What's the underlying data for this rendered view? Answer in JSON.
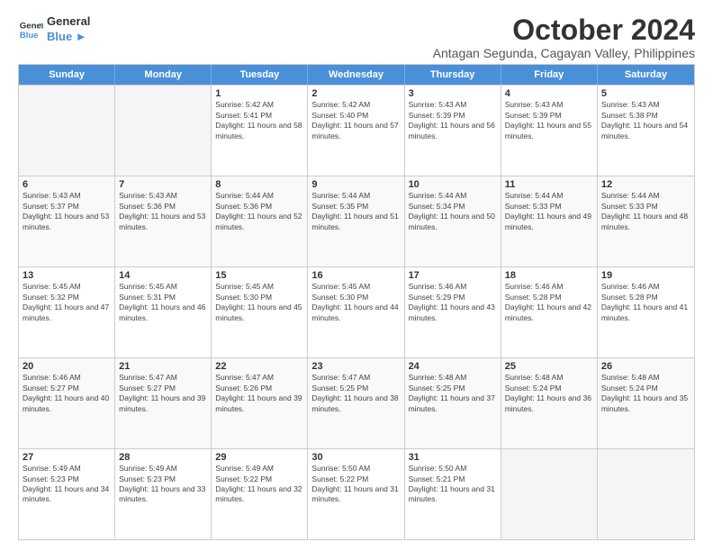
{
  "logo": {
    "line1": "General",
    "line2": "Blue",
    "arrow_color": "#4a90d9"
  },
  "title": "October 2024",
  "location": "Antagan Segunda, Cagayan Valley, Philippines",
  "header_days": [
    "Sunday",
    "Monday",
    "Tuesday",
    "Wednesday",
    "Thursday",
    "Friday",
    "Saturday"
  ],
  "weeks": [
    [
      {
        "day": "",
        "empty": true
      },
      {
        "day": "",
        "empty": true
      },
      {
        "day": "1",
        "sunrise": "5:42 AM",
        "sunset": "5:41 PM",
        "daylight": "11 hours and 58 minutes."
      },
      {
        "day": "2",
        "sunrise": "5:42 AM",
        "sunset": "5:40 PM",
        "daylight": "11 hours and 57 minutes."
      },
      {
        "day": "3",
        "sunrise": "5:43 AM",
        "sunset": "5:39 PM",
        "daylight": "11 hours and 56 minutes."
      },
      {
        "day": "4",
        "sunrise": "5:43 AM",
        "sunset": "5:39 PM",
        "daylight": "11 hours and 55 minutes."
      },
      {
        "day": "5",
        "sunrise": "5:43 AM",
        "sunset": "5:38 PM",
        "daylight": "11 hours and 54 minutes."
      }
    ],
    [
      {
        "day": "6",
        "sunrise": "5:43 AM",
        "sunset": "5:37 PM",
        "daylight": "11 hours and 53 minutes."
      },
      {
        "day": "7",
        "sunrise": "5:43 AM",
        "sunset": "5:36 PM",
        "daylight": "11 hours and 53 minutes."
      },
      {
        "day": "8",
        "sunrise": "5:44 AM",
        "sunset": "5:36 PM",
        "daylight": "11 hours and 52 minutes."
      },
      {
        "day": "9",
        "sunrise": "5:44 AM",
        "sunset": "5:35 PM",
        "daylight": "11 hours and 51 minutes."
      },
      {
        "day": "10",
        "sunrise": "5:44 AM",
        "sunset": "5:34 PM",
        "daylight": "11 hours and 50 minutes."
      },
      {
        "day": "11",
        "sunrise": "5:44 AM",
        "sunset": "5:33 PM",
        "daylight": "11 hours and 49 minutes."
      },
      {
        "day": "12",
        "sunrise": "5:44 AM",
        "sunset": "5:33 PM",
        "daylight": "11 hours and 48 minutes."
      }
    ],
    [
      {
        "day": "13",
        "sunrise": "5:45 AM",
        "sunset": "5:32 PM",
        "daylight": "11 hours and 47 minutes."
      },
      {
        "day": "14",
        "sunrise": "5:45 AM",
        "sunset": "5:31 PM",
        "daylight": "11 hours and 46 minutes."
      },
      {
        "day": "15",
        "sunrise": "5:45 AM",
        "sunset": "5:30 PM",
        "daylight": "11 hours and 45 minutes."
      },
      {
        "day": "16",
        "sunrise": "5:45 AM",
        "sunset": "5:30 PM",
        "daylight": "11 hours and 44 minutes."
      },
      {
        "day": "17",
        "sunrise": "5:46 AM",
        "sunset": "5:29 PM",
        "daylight": "11 hours and 43 minutes."
      },
      {
        "day": "18",
        "sunrise": "5:46 AM",
        "sunset": "5:28 PM",
        "daylight": "11 hours and 42 minutes."
      },
      {
        "day": "19",
        "sunrise": "5:46 AM",
        "sunset": "5:28 PM",
        "daylight": "11 hours and 41 minutes."
      }
    ],
    [
      {
        "day": "20",
        "sunrise": "5:46 AM",
        "sunset": "5:27 PM",
        "daylight": "11 hours and 40 minutes."
      },
      {
        "day": "21",
        "sunrise": "5:47 AM",
        "sunset": "5:27 PM",
        "daylight": "11 hours and 39 minutes."
      },
      {
        "day": "22",
        "sunrise": "5:47 AM",
        "sunset": "5:26 PM",
        "daylight": "11 hours and 39 minutes."
      },
      {
        "day": "23",
        "sunrise": "5:47 AM",
        "sunset": "5:25 PM",
        "daylight": "11 hours and 38 minutes."
      },
      {
        "day": "24",
        "sunrise": "5:48 AM",
        "sunset": "5:25 PM",
        "daylight": "11 hours and 37 minutes."
      },
      {
        "day": "25",
        "sunrise": "5:48 AM",
        "sunset": "5:24 PM",
        "daylight": "11 hours and 36 minutes."
      },
      {
        "day": "26",
        "sunrise": "5:48 AM",
        "sunset": "5:24 PM",
        "daylight": "11 hours and 35 minutes."
      }
    ],
    [
      {
        "day": "27",
        "sunrise": "5:49 AM",
        "sunset": "5:23 PM",
        "daylight": "11 hours and 34 minutes."
      },
      {
        "day": "28",
        "sunrise": "5:49 AM",
        "sunset": "5:23 PM",
        "daylight": "11 hours and 33 minutes."
      },
      {
        "day": "29",
        "sunrise": "5:49 AM",
        "sunset": "5:22 PM",
        "daylight": "11 hours and 32 minutes."
      },
      {
        "day": "30",
        "sunrise": "5:50 AM",
        "sunset": "5:22 PM",
        "daylight": "11 hours and 31 minutes."
      },
      {
        "day": "31",
        "sunrise": "5:50 AM",
        "sunset": "5:21 PM",
        "daylight": "11 hours and 31 minutes."
      },
      {
        "day": "",
        "empty": true
      },
      {
        "day": "",
        "empty": true
      }
    ]
  ],
  "colors": {
    "header_bg": "#4a90d9",
    "empty_cell_bg": "#f5f5f5",
    "shaded_row_bg": "#f9f9f9"
  },
  "labels": {
    "sunrise": "Sunrise:",
    "sunset": "Sunset:",
    "daylight": "Daylight:"
  }
}
